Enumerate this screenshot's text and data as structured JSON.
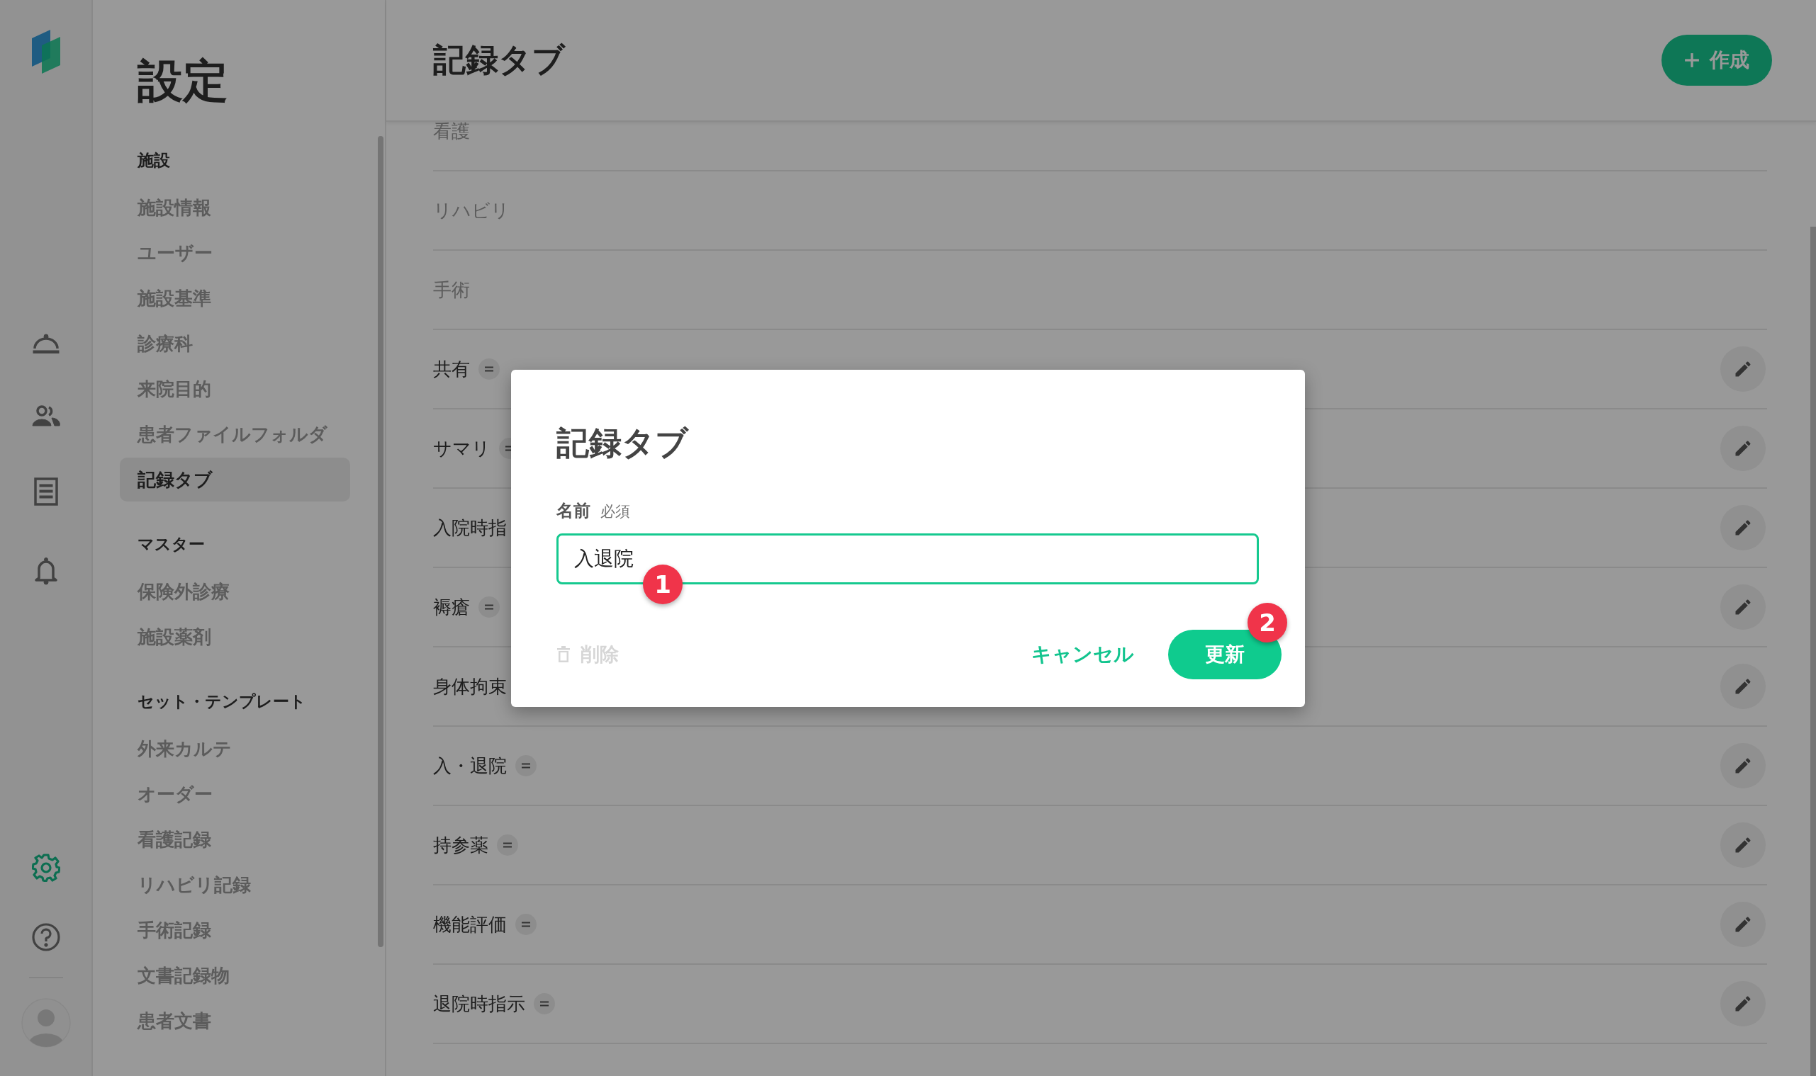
{
  "rail": {
    "top_icons": [
      {
        "kind": "tray",
        "selected": false
      },
      {
        "kind": "people",
        "selected": false
      },
      {
        "kind": "list",
        "selected": false
      },
      {
        "kind": "bell",
        "selected": false
      }
    ],
    "bottom_icons": [
      {
        "kind": "gear",
        "selected": true
      },
      {
        "kind": "help",
        "selected": false
      }
    ]
  },
  "sidebar": {
    "title": "設定",
    "sections": [
      {
        "heading": "施設",
        "items": [
          {
            "label": "施設情報",
            "selected": false
          },
          {
            "label": "ユーザー",
            "selected": false
          },
          {
            "label": "施設基準",
            "selected": false
          },
          {
            "label": "診療科",
            "selected": false
          },
          {
            "label": "来院目的",
            "selected": false
          },
          {
            "label": "患者ファイルフォルダ",
            "selected": false
          },
          {
            "label": "記録タブ",
            "selected": true
          }
        ]
      },
      {
        "heading": "マスター",
        "items": [
          {
            "label": "保険外診療",
            "selected": false
          },
          {
            "label": "施設薬剤",
            "selected": false
          }
        ]
      },
      {
        "heading": "セット・テンプレート",
        "items": [
          {
            "label": "外来カルテ",
            "selected": false
          },
          {
            "label": "オーダー",
            "selected": false
          },
          {
            "label": "看護記録",
            "selected": false
          },
          {
            "label": "リハビリ記録",
            "selected": false
          },
          {
            "label": "手術記録",
            "selected": false
          },
          {
            "label": "文書記録物",
            "selected": false
          },
          {
            "label": "患者文書",
            "selected": false
          }
        ]
      }
    ]
  },
  "main": {
    "title": "記録タブ",
    "create_button": {
      "label": "作成"
    },
    "rows": [
      {
        "name": "看護",
        "kind": "preset"
      },
      {
        "name": "リハビリ",
        "kind": "preset"
      },
      {
        "name": "手術",
        "kind": "preset"
      },
      {
        "name": "共有",
        "kind": "custom"
      },
      {
        "name": "サマリ",
        "kind": "custom"
      },
      {
        "name": "入院時指",
        "kind": "partial"
      },
      {
        "name": "褥瘡",
        "kind": "custom"
      },
      {
        "name": "身体拘束",
        "kind": "partial"
      },
      {
        "name": "入・退院",
        "kind": "custom"
      },
      {
        "name": "持参薬",
        "kind": "custom"
      },
      {
        "name": "機能評価",
        "kind": "custom"
      },
      {
        "name": "退院時指示",
        "kind": "custom"
      }
    ]
  },
  "dialog": {
    "title": "記録タブ",
    "field": {
      "label": "名前",
      "required_label": "必須",
      "value": "入退院",
      "focused": true
    },
    "delete_button": {
      "label": "削除",
      "disabled": true
    },
    "cancel_button": {
      "label": "キャンセル"
    },
    "submit_button": {
      "label": "更新"
    },
    "markers": [
      "1",
      "2"
    ]
  }
}
